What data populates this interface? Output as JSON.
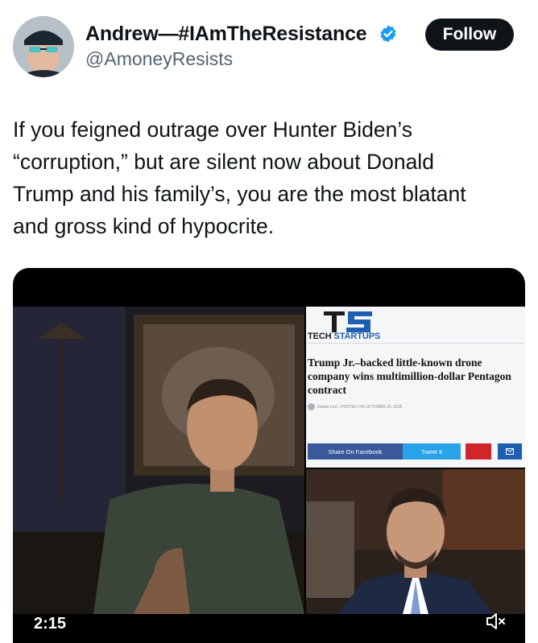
{
  "header": {
    "display_name": "Andrew—#IAmTheResistance",
    "handle": "@AmoneyResists",
    "follow_label": "Follow",
    "verified": true,
    "accent_color": "#1d9bf0",
    "icons": {
      "verified": "verified-badge-icon",
      "avatar": "avatar"
    }
  },
  "tweet": {
    "text": "If you feigned outrage over Hunter Biden’s\n“corruption,” but are silent now about Donald\nTrump and his family’s, you are the most blatant\nand gross kind of hypocrite."
  },
  "media": {
    "article": {
      "brand_prefix": "TECH",
      "brand_suffix": "STARTUPS",
      "headline": "Trump Jr.–backed little-known drone company wins multimillion-dollar Pentagon contract",
      "byline": "Daniel Levi · POSTED ON OCTOBER 15, 2025",
      "share_facebook": "Share On Facebook",
      "tweet_it": "Tweet It"
    },
    "timestamp": "2:15",
    "icons": {
      "mute": "mute-icon"
    }
  }
}
